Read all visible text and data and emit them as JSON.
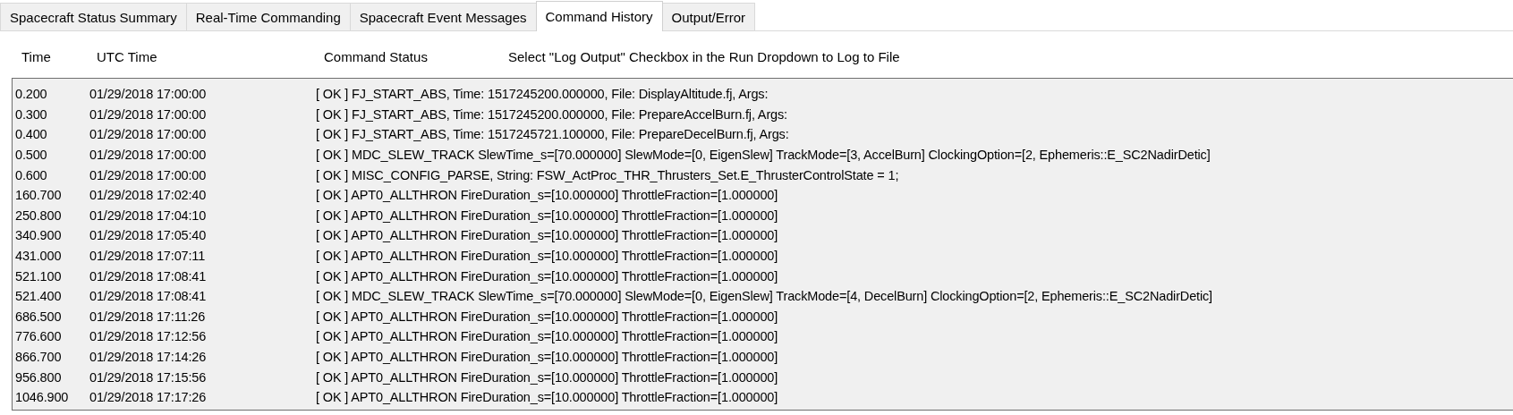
{
  "tabs": [
    {
      "label": "Spacecraft Status Summary",
      "selected": false
    },
    {
      "label": "Real-Time Commanding",
      "selected": false
    },
    {
      "label": "Spacecraft Event Messages",
      "selected": false
    },
    {
      "label": "Command History",
      "selected": true
    },
    {
      "label": "Output/Error",
      "selected": false
    }
  ],
  "log": {
    "columns": [
      "Time",
      "UTC Time",
      "Command Status"
    ],
    "hint": "Select \"Log Output\" Checkbox in the Run Dropdown to Log to File",
    "rows": [
      {
        "time": "0.200",
        "utc": "01/29/2018 17:00:00",
        "status": "[ OK ] FJ_START_ABS, Time: 1517245200.000000, File: DisplayAltitude.fj, Args:"
      },
      {
        "time": "0.300",
        "utc": "01/29/2018 17:00:00",
        "status": "[ OK ] FJ_START_ABS, Time: 1517245200.000000, File: PrepareAccelBurn.fj, Args:"
      },
      {
        "time": "0.400",
        "utc": "01/29/2018 17:00:00",
        "status": "[ OK ] FJ_START_ABS, Time: 1517245721.100000, File: PrepareDecelBurn.fj, Args:"
      },
      {
        "time": "0.500",
        "utc": "01/29/2018 17:00:00",
        "status": "[ OK ] MDC_SLEW_TRACK SlewTime_s=[70.000000] SlewMode=[0, EigenSlew] TrackMode=[3, AccelBurn] ClockingOption=[2, Ephemeris::E_SC2NadirDetic]"
      },
      {
        "time": "0.600",
        "utc": "01/29/2018 17:00:00",
        "status": "[ OK ] MISC_CONFIG_PARSE, String: FSW_ActProc_THR_Thrusters_Set.E_ThrusterControlState = 1;"
      },
      {
        "time": "160.700",
        "utc": "01/29/2018 17:02:40",
        "status": "[ OK ] APT0_ALLTHRON FireDuration_s=[10.000000] ThrottleFraction=[1.000000]"
      },
      {
        "time": "250.800",
        "utc": "01/29/2018 17:04:10",
        "status": "[ OK ] APT0_ALLTHRON FireDuration_s=[10.000000] ThrottleFraction=[1.000000]"
      },
      {
        "time": "340.900",
        "utc": "01/29/2018 17:05:40",
        "status": "[ OK ] APT0_ALLTHRON FireDuration_s=[10.000000] ThrottleFraction=[1.000000]"
      },
      {
        "time": "431.000",
        "utc": "01/29/2018 17:07:11",
        "status": "[ OK ] APT0_ALLTHRON FireDuration_s=[10.000000] ThrottleFraction=[1.000000]"
      },
      {
        "time": "521.100",
        "utc": "01/29/2018 17:08:41",
        "status": "[ OK ] APT0_ALLTHRON FireDuration_s=[10.000000] ThrottleFraction=[1.000000]"
      },
      {
        "time": "521.400",
        "utc": "01/29/2018 17:08:41",
        "status": "[ OK ] MDC_SLEW_TRACK SlewTime_s=[70.000000] SlewMode=[0, EigenSlew] TrackMode=[4, DecelBurn] ClockingOption=[2, Ephemeris::E_SC2NadirDetic]"
      },
      {
        "time": "686.500",
        "utc": "01/29/2018 17:11:26",
        "status": "[ OK ] APT0_ALLTHRON FireDuration_s=[10.000000] ThrottleFraction=[1.000000]"
      },
      {
        "time": "776.600",
        "utc": "01/29/2018 17:12:56",
        "status": "[ OK ] APT0_ALLTHRON FireDuration_s=[10.000000] ThrottleFraction=[1.000000]"
      },
      {
        "time": "866.700",
        "utc": "01/29/2018 17:14:26",
        "status": "[ OK ] APT0_ALLTHRON FireDuration_s=[10.000000] ThrottleFraction=[1.000000]"
      },
      {
        "time": "956.800",
        "utc": "01/29/2018 17:15:56",
        "status": "[ OK ] APT0_ALLTHRON FireDuration_s=[10.000000] ThrottleFraction=[1.000000]"
      },
      {
        "time": "1046.900",
        "utc": "01/29/2018 17:17:26",
        "status": "[ OK ] APT0_ALLTHRON FireDuration_s=[10.000000] ThrottleFraction=[1.000000]"
      }
    ]
  }
}
